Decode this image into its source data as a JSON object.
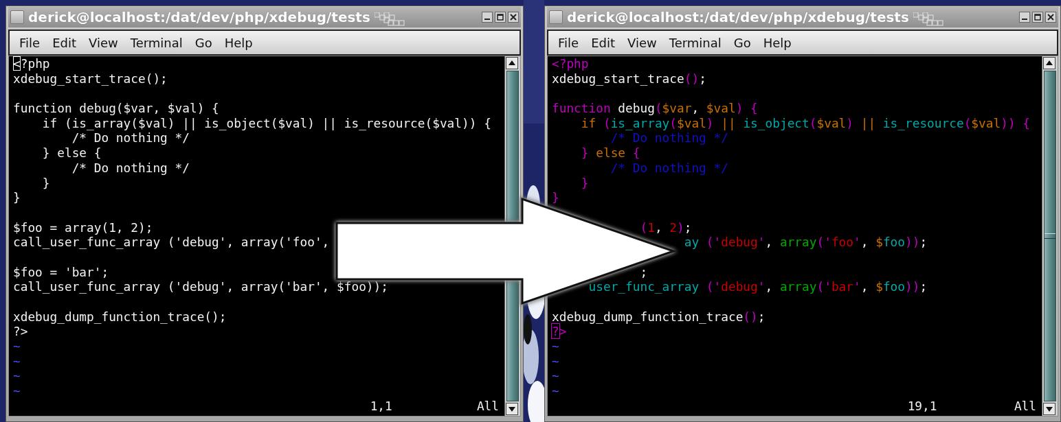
{
  "windows": [
    {
      "title": "derick@localhost:/dat/dev/php/xdebug/tests",
      "menu": [
        "File",
        "Edit",
        "View",
        "Terminal",
        "Go",
        "Help"
      ],
      "lines": [
        {
          "kind": "code",
          "segments": [
            {
              "text": "<",
              "kind": "cursor"
            },
            {
              "text": "?php",
              "kind": "plain"
            }
          ]
        },
        {
          "kind": "code",
          "segments": [
            {
              "text": "xdebug_start_trace();",
              "kind": "plain"
            }
          ]
        },
        {
          "kind": "blank"
        },
        {
          "kind": "code",
          "segments": [
            {
              "text": "function debug($var, $val) {",
              "kind": "plain"
            }
          ]
        },
        {
          "kind": "code",
          "segments": [
            {
              "text": "    if (is_array($val) || is_object($val) || is_resource($val)) {",
              "kind": "plain"
            }
          ]
        },
        {
          "kind": "code",
          "segments": [
            {
              "text": "        /* Do nothing */",
              "kind": "plain"
            }
          ]
        },
        {
          "kind": "code",
          "segments": [
            {
              "text": "    } else {",
              "kind": "plain"
            }
          ]
        },
        {
          "kind": "code",
          "segments": [
            {
              "text": "        /* Do nothing */",
              "kind": "plain"
            }
          ]
        },
        {
          "kind": "code",
          "segments": [
            {
              "text": "    }",
              "kind": "plain"
            }
          ]
        },
        {
          "kind": "code",
          "segments": [
            {
              "text": "}",
              "kind": "plain"
            }
          ]
        },
        {
          "kind": "blank"
        },
        {
          "kind": "code",
          "segments": [
            {
              "text": "$foo = array(1, 2);",
              "kind": "plain"
            }
          ]
        },
        {
          "kind": "code",
          "segments": [
            {
              "text": "call_user_func_array ('debug', array('foo',",
              "kind": "plain"
            }
          ]
        },
        {
          "kind": "blank"
        },
        {
          "kind": "code",
          "segments": [
            {
              "text": "$foo = 'bar';",
              "kind": "plain"
            }
          ]
        },
        {
          "kind": "code",
          "segments": [
            {
              "text": "call_user_func_array ('debug', array('bar', $foo));",
              "kind": "plain"
            }
          ]
        },
        {
          "kind": "blank"
        },
        {
          "kind": "code",
          "segments": [
            {
              "text": "xdebug_dump_function_trace();",
              "kind": "plain"
            }
          ]
        },
        {
          "kind": "code",
          "segments": [
            {
              "text": "?>",
              "kind": "plain"
            }
          ]
        },
        {
          "kind": "code",
          "segments": [
            {
              "text": "~",
              "kind": "nontext"
            }
          ]
        },
        {
          "kind": "code",
          "segments": [
            {
              "text": "~",
              "kind": "nontext"
            }
          ]
        },
        {
          "kind": "code",
          "segments": [
            {
              "text": "~",
              "kind": "nontext"
            }
          ]
        },
        {
          "kind": "code",
          "segments": [
            {
              "text": "~",
              "kind": "nontext"
            }
          ]
        }
      ],
      "ruler": "1,1",
      "position": "All"
    },
    {
      "title": "derick@localhost:/dat/dev/php/xdebug/tests",
      "menu": [
        "File",
        "Edit",
        "View",
        "Terminal",
        "Go",
        "Help"
      ],
      "lines": [
        {
          "kind": "code",
          "segments": [
            {
              "text": "<?php",
              "kind": "special"
            }
          ]
        },
        {
          "kind": "code",
          "segments": [
            {
              "text": "xdebug_start_trace",
              "kind": "plain"
            },
            {
              "text": "()",
              "kind": "special"
            },
            {
              "text": ";",
              "kind": "plain"
            }
          ]
        },
        {
          "kind": "blank"
        },
        {
          "kind": "code",
          "segments": [
            {
              "text": "function",
              "kind": "special"
            },
            {
              "text": " debug",
              "kind": "plain"
            },
            {
              "text": "(",
              "kind": "special"
            },
            {
              "text": "$var",
              "kind": "statement"
            },
            {
              "text": ", ",
              "kind": "plain"
            },
            {
              "text": "$val",
              "kind": "statement"
            },
            {
              "text": ") {",
              "kind": "special"
            }
          ]
        },
        {
          "kind": "code",
          "segments": [
            {
              "text": "    if",
              "kind": "statement"
            },
            {
              "text": " (",
              "kind": "special"
            },
            {
              "text": "is_array",
              "kind": "identifier"
            },
            {
              "text": "(",
              "kind": "special"
            },
            {
              "text": "$val",
              "kind": "statement"
            },
            {
              "text": ")",
              "kind": "special"
            },
            {
              "text": " || ",
              "kind": "statement"
            },
            {
              "text": "is_object",
              "kind": "identifier"
            },
            {
              "text": "(",
              "kind": "special"
            },
            {
              "text": "$val",
              "kind": "statement"
            },
            {
              "text": ")",
              "kind": "special"
            },
            {
              "text": " || ",
              "kind": "statement"
            },
            {
              "text": "is_resource",
              "kind": "identifier"
            },
            {
              "text": "(",
              "kind": "special"
            },
            {
              "text": "$val",
              "kind": "statement"
            },
            {
              "text": ")) {",
              "kind": "special"
            }
          ]
        },
        {
          "kind": "code",
          "segments": [
            {
              "text": "        /* Do nothing */",
              "kind": "comment"
            }
          ]
        },
        {
          "kind": "code",
          "segments": [
            {
              "text": "    } ",
              "kind": "special"
            },
            {
              "text": "else",
              "kind": "statement"
            },
            {
              "text": " {",
              "kind": "special"
            }
          ]
        },
        {
          "kind": "code",
          "segments": [
            {
              "text": "        /* Do nothing */",
              "kind": "comment"
            }
          ]
        },
        {
          "kind": "code",
          "segments": [
            {
              "text": "    }",
              "kind": "special"
            }
          ]
        },
        {
          "kind": "code",
          "segments": [
            {
              "text": "}",
              "kind": "special"
            }
          ]
        },
        {
          "kind": "blank"
        },
        {
          "kind": "code",
          "segments": [
            {
              "text": "            (",
              "kind": "special"
            },
            {
              "text": "1",
              "kind": "constant"
            },
            {
              "text": ", ",
              "kind": "plain"
            },
            {
              "text": "2",
              "kind": "constant"
            },
            {
              "text": ")",
              "kind": "special"
            },
            {
              "text": ";",
              "kind": "plain"
            }
          ]
        },
        {
          "kind": "code",
          "segments": [
            {
              "text": "                  ay",
              "kind": "identifier"
            },
            {
              "text": " (",
              "kind": "special"
            },
            {
              "text": "'",
              "kind": "special"
            },
            {
              "text": "debug",
              "kind": "constant"
            },
            {
              "text": "'",
              "kind": "special"
            },
            {
              "text": ", ",
              "kind": "plain"
            },
            {
              "text": "array",
              "kind": "builtin"
            },
            {
              "text": "(",
              "kind": "special"
            },
            {
              "text": "'",
              "kind": "special"
            },
            {
              "text": "foo",
              "kind": "constant"
            },
            {
              "text": "'",
              "kind": "special"
            },
            {
              "text": ", ",
              "kind": "plain"
            },
            {
              "text": "$",
              "kind": "statement"
            },
            {
              "text": "foo",
              "kind": "identifier"
            },
            {
              "text": "))",
              "kind": "special"
            },
            {
              "text": ";",
              "kind": "plain"
            }
          ]
        },
        {
          "kind": "blank"
        },
        {
          "kind": "code",
          "segments": [
            {
              "text": "            ;",
              "kind": "plain"
            }
          ]
        },
        {
          "kind": "code",
          "segments": [
            {
              "text": "     user_func_array",
              "kind": "identifier"
            },
            {
              "text": " (",
              "kind": "special"
            },
            {
              "text": "'",
              "kind": "special"
            },
            {
              "text": "debug",
              "kind": "constant"
            },
            {
              "text": "'",
              "kind": "special"
            },
            {
              "text": ", ",
              "kind": "plain"
            },
            {
              "text": "array",
              "kind": "builtin"
            },
            {
              "text": "(",
              "kind": "special"
            },
            {
              "text": "'",
              "kind": "special"
            },
            {
              "text": "bar",
              "kind": "constant"
            },
            {
              "text": "'",
              "kind": "special"
            },
            {
              "text": ", ",
              "kind": "plain"
            },
            {
              "text": "$",
              "kind": "statement"
            },
            {
              "text": "foo",
              "kind": "identifier"
            },
            {
              "text": "))",
              "kind": "special"
            },
            {
              "text": ";",
              "kind": "plain"
            }
          ]
        },
        {
          "kind": "blank"
        },
        {
          "kind": "code",
          "segments": [
            {
              "text": "xdebug_dump_function_trace",
              "kind": "plain"
            },
            {
              "text": "()",
              "kind": "special"
            },
            {
              "text": ";",
              "kind": "plain"
            }
          ]
        },
        {
          "kind": "code",
          "segments": [
            {
              "text": "?",
              "kind": "cursor-special"
            },
            {
              "text": ">",
              "kind": "special"
            }
          ]
        },
        {
          "kind": "code",
          "segments": [
            {
              "text": "~",
              "kind": "nontext"
            }
          ]
        },
        {
          "kind": "code",
          "segments": [
            {
              "text": "~",
              "kind": "nontext"
            }
          ]
        },
        {
          "kind": "code",
          "segments": [
            {
              "text": "~",
              "kind": "nontext"
            }
          ]
        },
        {
          "kind": "code",
          "segments": [
            {
              "text": "~",
              "kind": "nontext"
            }
          ]
        }
      ],
      "ruler": "19,1",
      "position": "All"
    }
  ]
}
